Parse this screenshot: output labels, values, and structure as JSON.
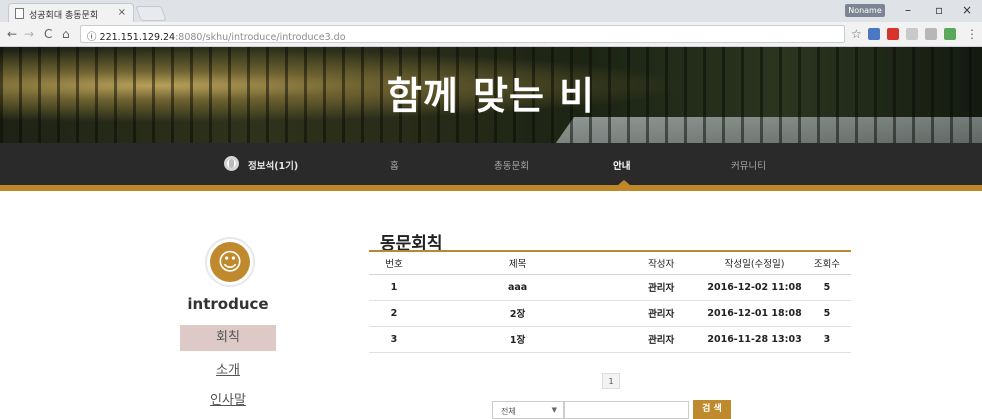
{
  "browser": {
    "tab_title": "성공회대 총동문회",
    "tab_close": "×",
    "profile_label": "Noname",
    "min": "–",
    "max": "▫",
    "close": "×",
    "url_host": "221.151.129.24",
    "url_path": ":8080/skhu/introduce/introduce3.do",
    "back": "←",
    "forward": "→",
    "reload": "C",
    "home": "⌂",
    "star": "☆",
    "info": "ⓘ",
    "menu": "⋮"
  },
  "banner": {
    "title": "함께 맞는 비"
  },
  "nav": {
    "user_name": "정보석(1기)",
    "items": [
      "홈",
      "총동문회",
      "안내",
      "커뮤니티"
    ],
    "active_index": 2
  },
  "sidebar": {
    "emblem": "☺",
    "title": "introduce",
    "items": [
      "회칙",
      "소개",
      "인사말"
    ],
    "active_index": 0
  },
  "board": {
    "title": "동문회칙",
    "headers": [
      "번호",
      "제목",
      "작성자",
      "작성일(수정일)",
      "조회수"
    ],
    "rows": [
      [
        "1",
        "aaa",
        "관리자",
        "2016-12-02 11:08",
        "5"
      ],
      [
        "2",
        "2장",
        "관리자",
        "2016-12-01 18:08",
        "5"
      ],
      [
        "3",
        "1장",
        "관리자",
        "2016-11-28 13:03",
        "3"
      ]
    ],
    "page": "1"
  },
  "search": {
    "scope": "전체",
    "scope_arrow": "▼",
    "button": "검 색"
  },
  "colors": {
    "accent": "#bf892d",
    "nav_bg": "#2a2a2a",
    "sidebar_active": "#ddc9c6"
  }
}
